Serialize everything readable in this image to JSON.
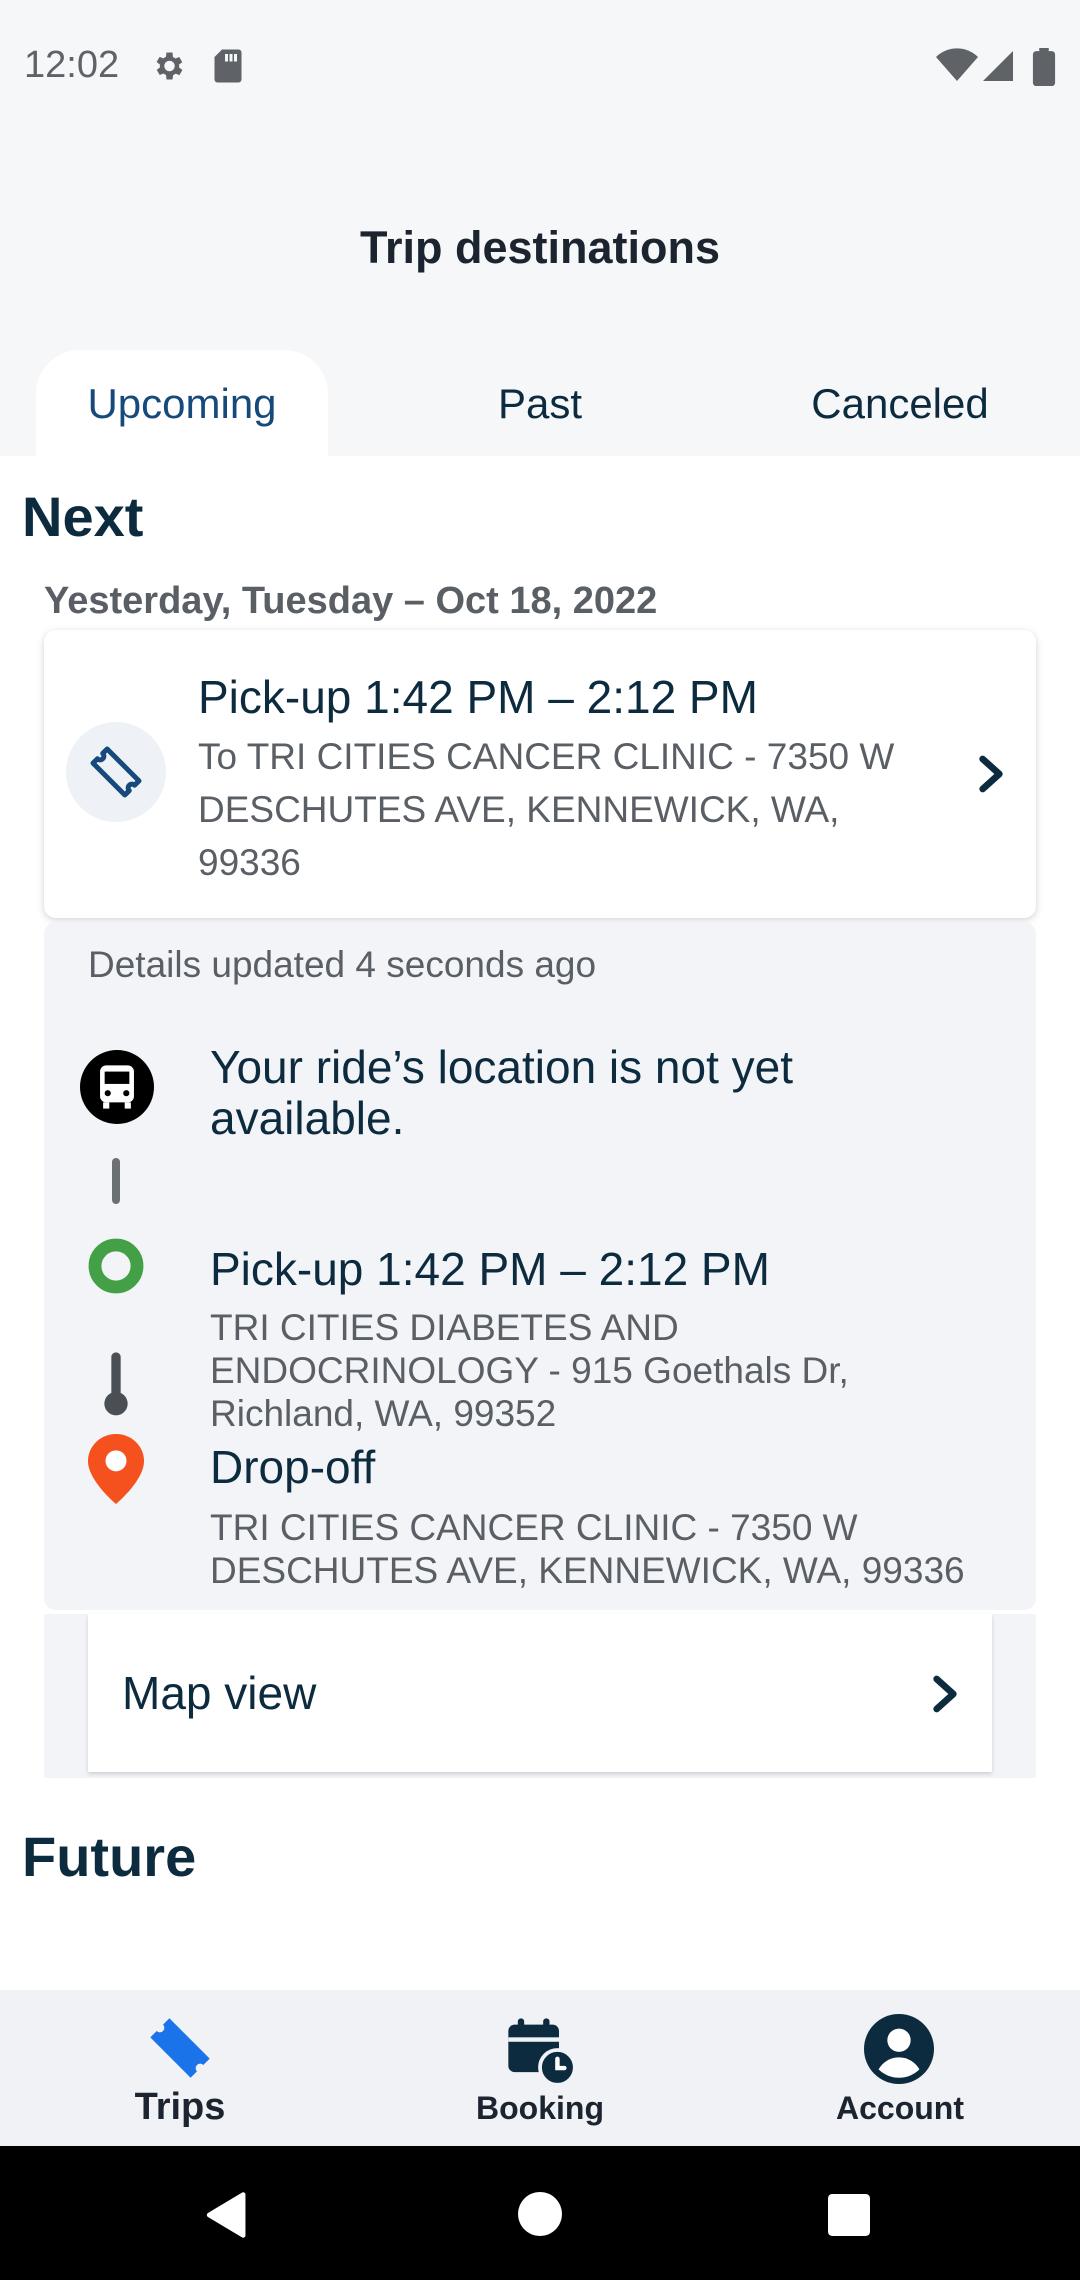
{
  "status_bar": {
    "time": "12:02"
  },
  "header": {
    "title": "Trip destinations"
  },
  "tabs": [
    {
      "label": "Upcoming",
      "active": true
    },
    {
      "label": "Past",
      "active": false
    },
    {
      "label": "Canceled",
      "active": false
    }
  ],
  "next": {
    "title": "Next",
    "date": "Yesterday, Tuesday – Oct 18, 2022",
    "card": {
      "time": "Pick-up 1:42 PM – 2:12 PM",
      "destination": "To TRI CITIES CANCER CLINIC - 7350 W DESCHUTES AVE, KENNEWICK, WA, 99336"
    },
    "details": {
      "updated": "Details updated 4 seconds ago",
      "ride_status": "Your ride’s location is not yet available.",
      "pickup_title": "Pick-up 1:42 PM – 2:12 PM",
      "pickup_address": "TRI CITIES DIABETES AND ENDOCRINOLOGY - 915 Goethals Dr, Richland, WA, 99352",
      "dropoff_title": "Drop-off",
      "dropoff_address": "TRI CITIES CANCER CLINIC - 7350 W DESCHUTES AVE, KENNEWICK, WA, 99336"
    },
    "map_view": "Map view"
  },
  "future": {
    "title": "Future"
  },
  "bottom_nav": [
    {
      "label": "Trips",
      "icon": "ticket-icon",
      "active": true
    },
    {
      "label": "Booking",
      "icon": "calendar-clock-icon",
      "active": false
    },
    {
      "label": "Account",
      "icon": "account-icon",
      "active": false
    }
  ],
  "colors": {
    "primary": "#0d2b3e",
    "accent_blue": "#1a73e8",
    "pickup_green": "#43a047",
    "dropoff_red": "#f4511e",
    "muted_text": "#5a5f66",
    "panel_bg": "#f2f4f8"
  }
}
